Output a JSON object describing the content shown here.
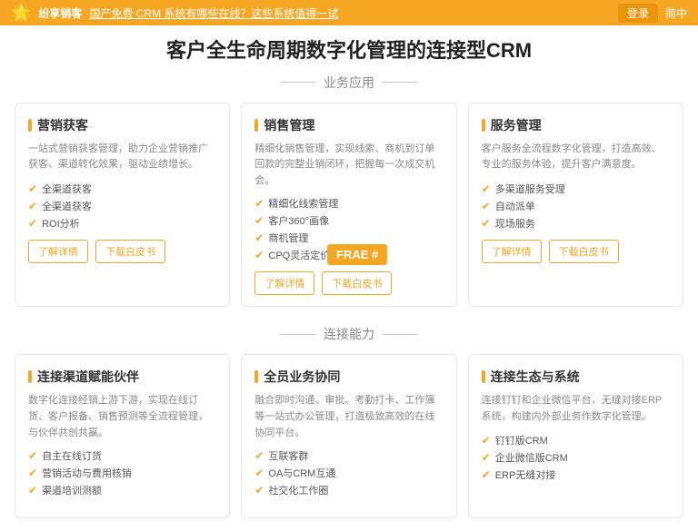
{
  "topbar": {
    "logo": "🌟",
    "brand": "纷享销客",
    "headline": "国产免费 CRM 系统有哪些在线？这些系统值得一试",
    "login_label": "登录",
    "lang_label": "简中"
  },
  "hero": {
    "title": "客户全生命周期数字化管理的连接型CRM",
    "sections": [
      {
        "id": "biz",
        "label": "业务应用"
      },
      {
        "id": "connect",
        "label": "连接能力"
      }
    ]
  },
  "biz_cards": [
    {
      "title": "营销获客",
      "desc": "一站式营销获客管理，助力企业营销推广获客、渠道转化效果，驱动业绩增长。",
      "features": [
        "全渠道获客",
        "全渠道获客",
        "ROI分析"
      ],
      "btn1": "了解详情",
      "btn2": "下载白皮书"
    },
    {
      "title": "销售管理",
      "desc": "精细化销售管理，实现线索、商机到订单回款的完整业销闭环，把握每一次成交机会。",
      "features": [
        "精细化线索管理",
        "客户360°画像",
        "商机管理",
        "CPQ灵活定价"
      ],
      "btn1": "了解详情",
      "btn2": "下载白皮书"
    },
    {
      "title": "服务管理",
      "desc": "客户服务全流程数字化管理，打造高效、专业的服务体验，提升客户满意度。",
      "features": [
        "多渠道服务受理",
        "自动派单",
        "现场服务"
      ],
      "btn1": "了解详情",
      "btn2": "下载白皮书"
    }
  ],
  "connect_cards": [
    {
      "title": "连接渠道赋能伙伴",
      "desc": "数字化连接经销上游下游，实现在线订货、客户报备、销售预测等全流程管理，与伙伴共创共赢。",
      "features": [
        "自主在线订货",
        "营销活动与费用核销",
        "渠道培训测额"
      ],
      "btn1": "",
      "btn2": ""
    },
    {
      "title": "全员业务协同",
      "desc": "融合即时沟通、审批、考勤打卡、工作簿等一站式办公管理，打造极致高效的在线协同平台。",
      "features": [
        "互联客群",
        "OA与CRM互通",
        "社交化工作圈"
      ],
      "btn1": "",
      "btn2": ""
    },
    {
      "title": "连接生态与系统",
      "desc": "连接钉钉和企业微信平台，无缝对接ERP系统，构建内外部业务作数字化管理。",
      "features": [
        "钉钉版CRM",
        "企业微信版CRM",
        "ERP无缝对接"
      ],
      "btn1": "",
      "btn2": ""
    }
  ],
  "frae_badge": "FRAE #"
}
